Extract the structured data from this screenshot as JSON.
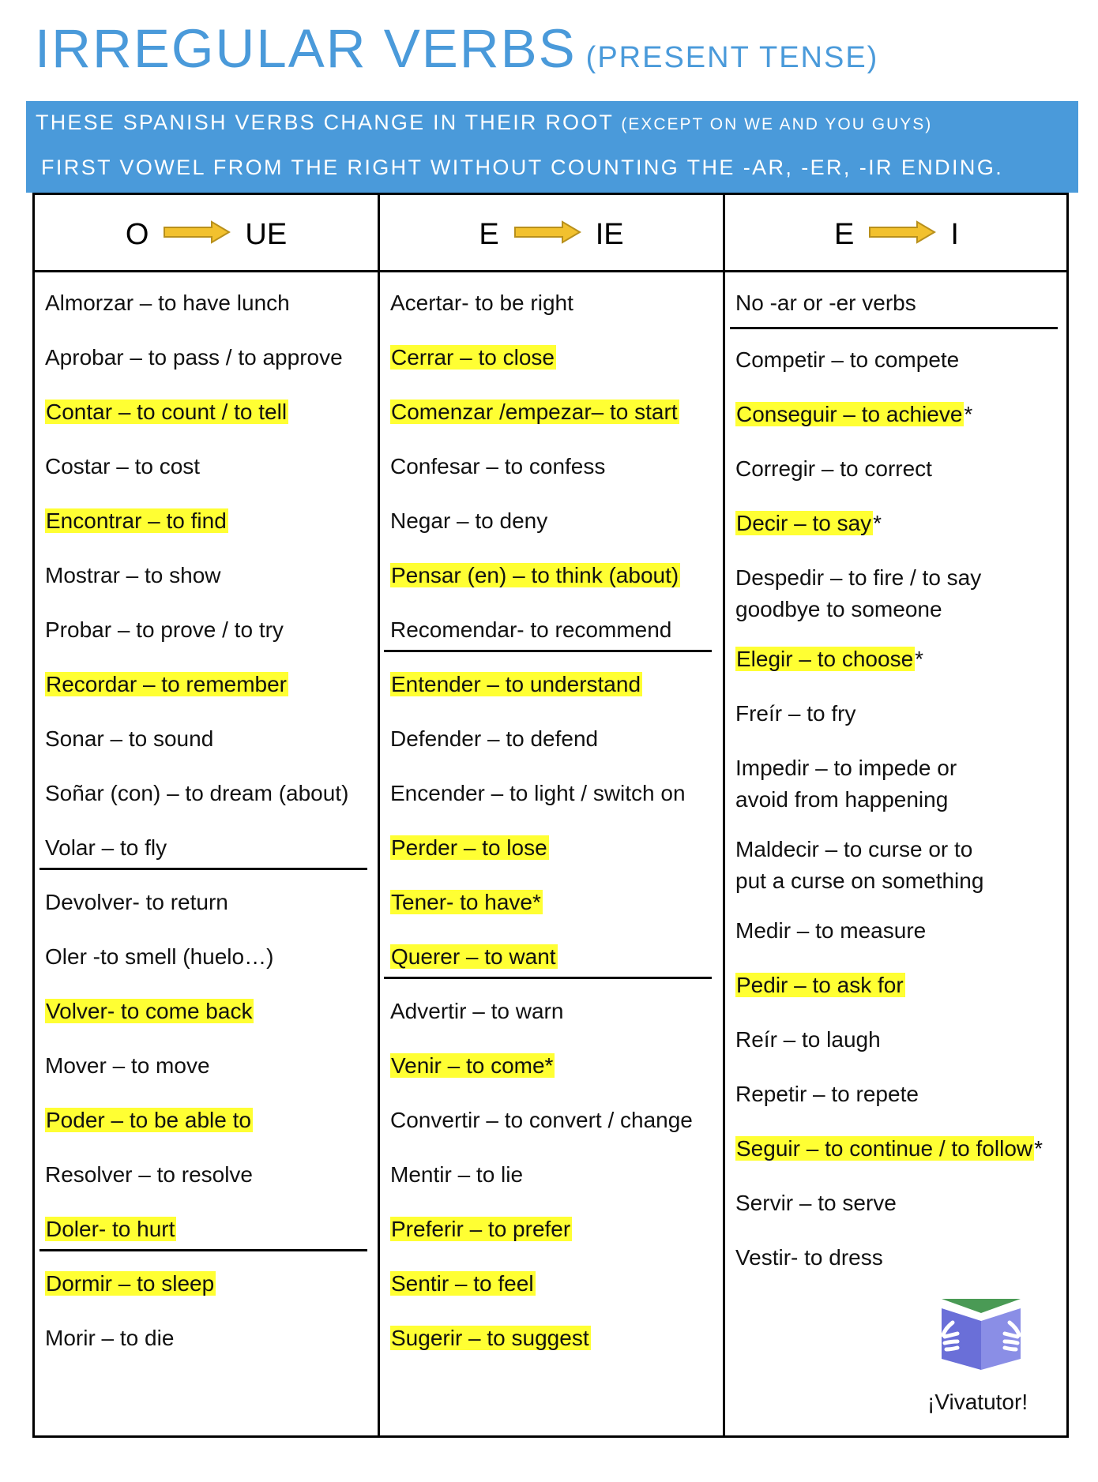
{
  "title": {
    "main": "IRREGULAR VERBS",
    "sub": "(PRESENT TENSE)"
  },
  "banner": {
    "line1_main": "THESE SPANISH VERBS CHANGE IN THEIR ROOT",
    "line1_note": "(EXCEPT ON WE AND YOU GUYS)",
    "line2": "FIRST VOWEL FROM THE RIGHT WITHOUT COUNTING THE -AR, -ER, -IR ENDING."
  },
  "colors": {
    "accent": "#4a9ada",
    "highlight": "#ffff33",
    "arrow_fill": "#f2c12e",
    "arrow_stroke": "#b8901c"
  },
  "columns": [
    {
      "from": "O",
      "to": "UE",
      "groups": [
        [
          {
            "text": "Almorzar – to have lunch",
            "highlight": false,
            "suffix": ""
          },
          {
            "text": "Aprobar – to pass / to approve",
            "highlight": false,
            "suffix": ""
          },
          {
            "text": "Contar – to count / to tell",
            "highlight": true,
            "suffix": ""
          },
          {
            "text": "Costar – to cost",
            "highlight": false,
            "suffix": ""
          },
          {
            "text": "Encontrar – to find",
            "highlight": true,
            "suffix": ""
          },
          {
            "text": "Mostrar – to show",
            "highlight": false,
            "suffix": ""
          },
          {
            "text": "Probar – to prove / to try",
            "highlight": false,
            "suffix": ""
          },
          {
            "text": "Recordar – to remember",
            "highlight": true,
            "suffix": ""
          },
          {
            "text": "Sonar – to sound",
            "highlight": false,
            "suffix": ""
          },
          {
            "text": "Soñar (con) – to dream (about)",
            "highlight": false,
            "suffix": ""
          },
          {
            "text": "Volar – to fly",
            "highlight": false,
            "suffix": ""
          }
        ],
        [
          {
            "text": "Devolver- to return",
            "highlight": false,
            "suffix": ""
          },
          {
            "text": "Oler -to smell  (huelo…)",
            "highlight": false,
            "suffix": ""
          },
          {
            "text": "Volver- to come back",
            "highlight": true,
            "suffix": ""
          },
          {
            "text": "Mover – to move",
            "highlight": false,
            "suffix": ""
          },
          {
            "text": "Poder – to be able to",
            "highlight": true,
            "suffix": ""
          },
          {
            "text": "Resolver – to resolve",
            "highlight": false,
            "suffix": ""
          },
          {
            "text": "Doler- to hurt",
            "highlight": true,
            "suffix": ""
          }
        ],
        [
          {
            "text": "Dormir – to sleep",
            "highlight": true,
            "suffix": ""
          },
          {
            "text": "Morir – to die",
            "highlight": false,
            "suffix": ""
          }
        ]
      ]
    },
    {
      "from": "E",
      "to": "IE",
      "groups": [
        [
          {
            "text": "Acertar- to be right",
            "highlight": false,
            "suffix": ""
          },
          {
            "text": "Cerrar – to close",
            "highlight": true,
            "suffix": ""
          },
          {
            "text": "Comenzar /empezar– to start",
            "highlight": true,
            "suffix": ""
          },
          {
            "text": "Confesar – to confess",
            "highlight": false,
            "suffix": ""
          },
          {
            "text": "Negar – to deny",
            "highlight": false,
            "suffix": ""
          },
          {
            "text": "Pensar (en) – to think (about)",
            "highlight": true,
            "suffix": ""
          },
          {
            "text": "Recomendar- to recommend",
            "highlight": false,
            "suffix": ""
          }
        ],
        [
          {
            "text": "Entender – to understand",
            "highlight": true,
            "suffix": ""
          },
          {
            "text": "Defender – to defend",
            "highlight": false,
            "suffix": ""
          },
          {
            "text": "Encender – to light / switch on",
            "highlight": false,
            "suffix": ""
          },
          {
            "text": "Perder – to lose",
            "highlight": true,
            "suffix": ""
          },
          {
            "text": "Tener- to have*",
            "highlight": true,
            "suffix": ""
          },
          {
            "text": "Querer – to want",
            "highlight": true,
            "suffix": ""
          }
        ],
        [
          {
            "text": "Advertir – to warn",
            "highlight": false,
            "suffix": ""
          },
          {
            "text": "Venir – to come*",
            "highlight": true,
            "suffix": ""
          },
          {
            "text": "Convertir – to convert / change",
            "highlight": false,
            "suffix": ""
          },
          {
            "text": "Mentir – to lie",
            "highlight": false,
            "suffix": ""
          },
          {
            "text": "Preferir – to prefer",
            "highlight": true,
            "suffix": ""
          },
          {
            "text": "Sentir – to feel",
            "highlight": true,
            "suffix": ""
          },
          {
            "text": "Sugerir – to suggest",
            "highlight": true,
            "suffix": ""
          }
        ]
      ]
    },
    {
      "from": "E",
      "to": "I",
      "groups": [
        [
          {
            "text": "No -ar or -er verbs",
            "highlight": false,
            "suffix": ""
          }
        ],
        [
          {
            "text": "Competir – to compete",
            "highlight": false,
            "suffix": ""
          },
          {
            "text": "Conseguir – to achieve",
            "highlight": true,
            "suffix": "*"
          },
          {
            "text": "Corregir – to correct",
            "highlight": false,
            "suffix": ""
          },
          {
            "text": "Decir – to say",
            "highlight": true,
            "suffix": "*"
          },
          {
            "text": "Despedir – to fire / to say goodbye to someone",
            "highlight": false,
            "suffix": "",
            "lines": 2
          },
          {
            "text": "Elegir – to choose",
            "highlight": true,
            "suffix": "*"
          },
          {
            "text": "Freír – to fry",
            "highlight": false,
            "suffix": ""
          },
          {
            "text": "Impedir – to impede or avoid from happening",
            "highlight": false,
            "suffix": "",
            "lines": 2
          },
          {
            "text": "Maldecir –  to curse or to put a curse on something",
            "highlight": false,
            "suffix": "",
            "lines": 2
          },
          {
            "text": "Medir – to measure",
            "highlight": false,
            "suffix": ""
          },
          {
            "text": "Pedir – to ask for",
            "highlight": true,
            "suffix": ""
          },
          {
            "text": "Reír – to laugh",
            "highlight": false,
            "suffix": ""
          },
          {
            "text": "Repetir – to repete",
            "highlight": false,
            "suffix": ""
          },
          {
            "text": "Seguir – to continue / to follow",
            "highlight": true,
            "suffix": "*"
          },
          {
            "text": "Servir – to serve",
            "highlight": false,
            "suffix": ""
          },
          {
            "text": "Vestir- to dress",
            "highlight": false,
            "suffix": ""
          }
        ]
      ]
    }
  ],
  "footer": {
    "logo_icon": "open-book-with-hands-icon",
    "brand": "¡Vivatutor!"
  }
}
